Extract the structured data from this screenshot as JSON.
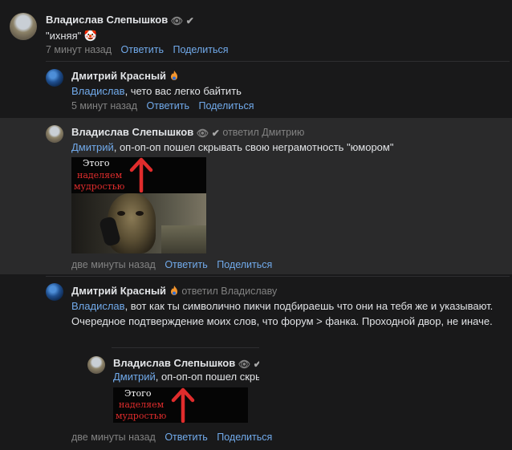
{
  "comments": [
    {
      "author": "Владислав Слепышков",
      "reply_to": "",
      "text": "\"ихняя\" 🤡",
      "time": "7 минут назад",
      "actions": [
        "Ответить",
        "Поделиться"
      ]
    },
    {
      "author": "Дмитрий Красный",
      "reply_to": "",
      "mention": "Владислав",
      "text": ", чето вас легко байтить",
      "time": "5 минут назад",
      "actions": [
        "Ответить",
        "Поделиться"
      ]
    },
    {
      "author": "Владислав Слепышков",
      "reply_to": "ответил Дмитрию",
      "mention": "Дмитрий",
      "text": ", оп-оп-оп пошел скрывать свою неграмотность \"юмором\"",
      "image_text": [
        "Этого",
        "наделяем",
        "мудростью"
      ],
      "time": "две минуты назад",
      "actions": [
        "Ответить",
        "Поделиться"
      ]
    },
    {
      "author": "Дмитрий Красный",
      "reply_to": "ответил Владиславу",
      "mention": "Владислав",
      "text": ", вот как ты символично пикчи подбираешь что они на тебя же и указывают. Очередное подтверждение моих слов, что форум > фанка. Проходной двор, не иначе.",
      "quote": {
        "author": "Владислав Слепышков",
        "mention": "Дмитрий",
        "text": ", оп-оп-оп пошел скры",
        "image_text": [
          "Этого",
          "наделяем",
          "мудростью"
        ]
      },
      "time": "две минуты назад",
      "actions": [
        "Ответить",
        "Поделиться"
      ]
    }
  ],
  "icons": {
    "eye": "eye-icon",
    "check": "checkmark-icon",
    "flame": "flame-icon"
  },
  "colors": {
    "background": "#19191a",
    "highlight": "#2a2a2b",
    "link": "#71aaeb",
    "meta": "#828282",
    "arrow": "#e02c2c"
  }
}
